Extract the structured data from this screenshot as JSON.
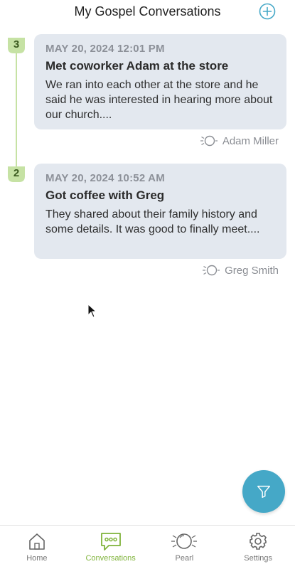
{
  "header": {
    "title": "My Gospel Conversations",
    "add_icon": "plus-circle-icon",
    "accent": "#45a8c7"
  },
  "conversations": [
    {
      "number": "3",
      "date": "MAY 20, 2024 12:01 PM",
      "title": "Met coworker Adam at the store",
      "body": "We ran into each other at the store and he said he was interested in hearing more about our church....",
      "person": "Adam Miller"
    },
    {
      "number": "2",
      "date": "MAY 20, 2024 10:52 AM",
      "title": "Got coffee with Greg",
      "body": "They shared about their family history and some details. It was good to finally meet....",
      "person": "Greg Smith"
    }
  ],
  "fab": {
    "icon": "filter-icon",
    "color": "#45a8c7"
  },
  "tabbar": {
    "active_color": "#7fb33a",
    "items": [
      {
        "label": "Home",
        "icon": "home-icon"
      },
      {
        "label": "Conversations",
        "icon": "chat-icon"
      },
      {
        "label": "Pearl",
        "icon": "pearl-icon"
      },
      {
        "label": "Settings",
        "icon": "gear-icon"
      }
    ]
  }
}
